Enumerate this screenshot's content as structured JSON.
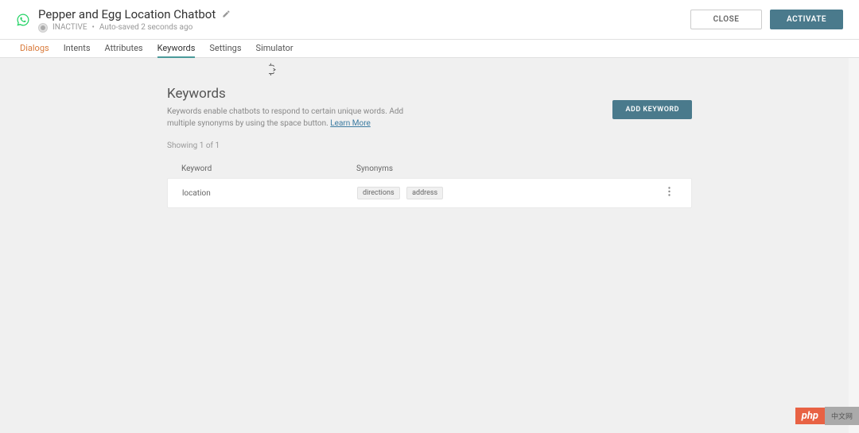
{
  "header": {
    "title": "Pepper and Egg Location Chatbot",
    "status_label": "INACTIVE",
    "autosave_text": "Auto-saved 2 seconds ago",
    "close_label": "CLOSE",
    "activate_label": "ACTIVATE"
  },
  "tabs": {
    "items": [
      {
        "label": "Dialogs",
        "key": "dialogs"
      },
      {
        "label": "Intents",
        "key": "intents"
      },
      {
        "label": "Attributes",
        "key": "attributes"
      },
      {
        "label": "Keywords",
        "key": "keywords"
      },
      {
        "label": "Settings",
        "key": "settings"
      },
      {
        "label": "Simulator",
        "key": "simulator"
      }
    ],
    "active": "keywords",
    "highlighted": "dialogs"
  },
  "section": {
    "heading": "Keywords",
    "description": "Keywords enable chatbots to respond to certain unique words. Add multiple synonyms by using the space button. ",
    "learn_more": "Learn More",
    "add_button": "ADD KEYWORD",
    "showing_text": "Showing 1 of 1"
  },
  "table": {
    "columns": {
      "keyword": "Keyword",
      "synonyms": "Synonyms"
    },
    "rows": [
      {
        "keyword": "location",
        "synonyms": [
          "directions",
          "address"
        ]
      }
    ]
  },
  "watermark": {
    "left": "php",
    "right": "中文网"
  },
  "colors": {
    "primary_button": "#4a7a8c",
    "tab_active_border": "#4a9a9a",
    "tab_highlight": "#d97a3a",
    "link": "#3a7aa0",
    "watermark_bg": "#e86244"
  }
}
